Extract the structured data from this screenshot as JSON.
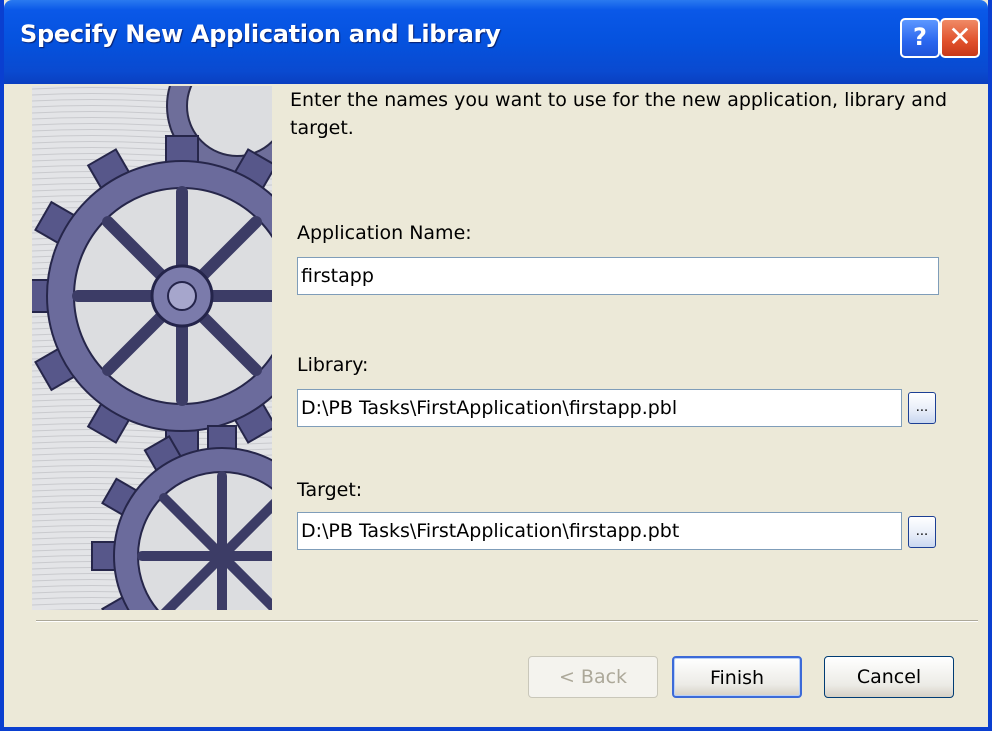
{
  "window": {
    "title": "Specify New Application and Library",
    "help_glyph": "?",
    "close_glyph": "✕"
  },
  "intro": "Enter the names you want to use for the new application, library and target.",
  "fields": {
    "application": {
      "label": "Application Name:",
      "value": "firstapp"
    },
    "library": {
      "label": "Library:",
      "value": "D:\\PB Tasks\\FirstApplication\\firstapp.pbl",
      "browse_label": "..."
    },
    "target": {
      "label": "Target:",
      "value": "D:\\PB Tasks\\FirstApplication\\firstapp.pbt",
      "browse_label": "..."
    }
  },
  "buttons": {
    "back": "< Back",
    "finish": "Finish",
    "cancel": "Cancel"
  },
  "colors": {
    "titlebar": "#0552de",
    "dialog_bg": "#ece9d8",
    "field_border": "#7f9db9"
  }
}
